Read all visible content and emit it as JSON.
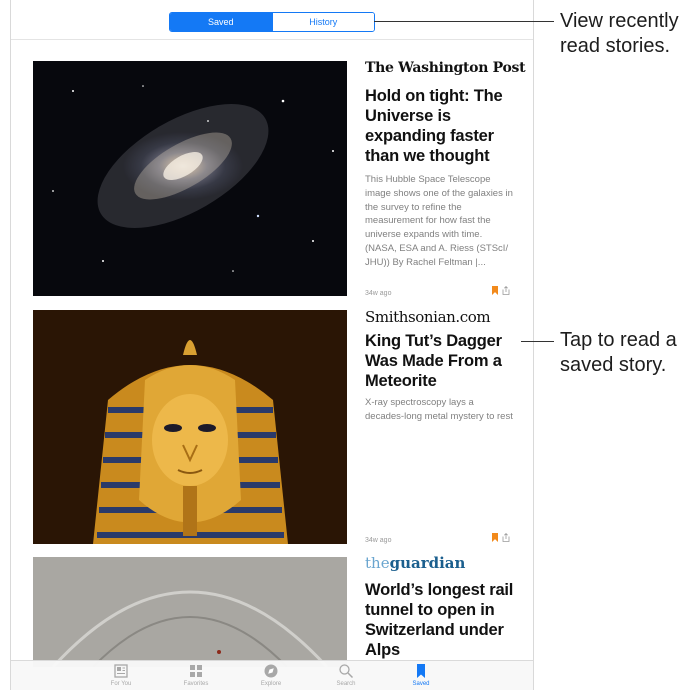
{
  "segmented": {
    "saved": "Saved",
    "history": "History"
  },
  "stories": [
    {
      "publisher": "The Washington Post",
      "headline": "Hold on tight: The Universe is expanding faster than we thought",
      "excerpt": "This Hubble Space Telescope image shows one of the galaxies in the survey to refine the measurement for how fast the universe expands with time. (NASA, ESA and A. Riess (STScI/ JHU)) By Rachel Feltman |...",
      "age": "34w ago",
      "image": "spiral-galaxy"
    },
    {
      "publisher": "Smithsonian.com",
      "headline": "King Tut’s Dagger Was Made From a Meteorite",
      "excerpt": "X-ray spectroscopy lays a decades-long metal mystery to rest",
      "age": "34w ago",
      "image": "tutankhamun-mask"
    },
    {
      "publisher_prefix": "the",
      "publisher_main": "guardian",
      "headline": "World’s longest rail tunnel to open in Switzerland under Alps",
      "image": "rail-tunnel"
    }
  ],
  "tabs": [
    {
      "label": "For You",
      "icon": "news-icon"
    },
    {
      "label": "Favorites",
      "icon": "grid-icon"
    },
    {
      "label": "Explore",
      "icon": "compass-icon"
    },
    {
      "label": "Search",
      "icon": "search-icon"
    },
    {
      "label": "Saved",
      "icon": "bookmark-icon",
      "active": true
    }
  ],
  "callouts": {
    "history": "View recently read stories.",
    "saved_story": "Tap to read a saved story."
  },
  "colors": {
    "accent": "#1479f5",
    "bookmark": "#f28a1c",
    "guardian_blue": "#1b5f8e"
  }
}
